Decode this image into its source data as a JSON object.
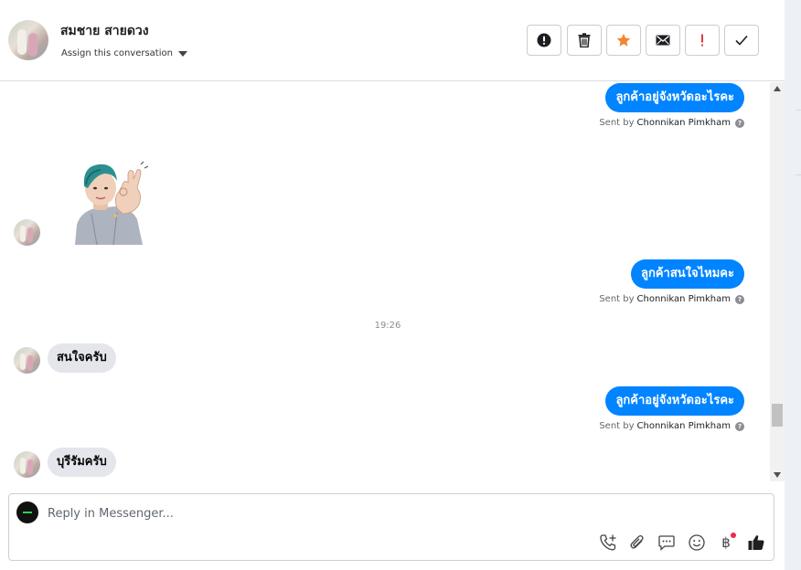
{
  "header": {
    "contact_name": "สมชาย สายดวง",
    "assign_label": "Assign this conversation"
  },
  "toolbar": {
    "buttons": [
      {
        "name": "info",
        "icon": "alert-circle-icon"
      },
      {
        "name": "delete",
        "icon": "trash-icon"
      },
      {
        "name": "star",
        "icon": "star-icon",
        "color": "#f5842b"
      },
      {
        "name": "mail",
        "icon": "envelope-icon"
      },
      {
        "name": "important",
        "icon": "exclamation-icon",
        "color": "#e0393e"
      },
      {
        "name": "done",
        "icon": "check-icon"
      }
    ]
  },
  "messages": [
    {
      "type": "outgoing",
      "text": "ลูกค้าอยู่จังหวัดอะไรคะ",
      "sent_by_prefix": "Sent by",
      "agent": "Chonnikan Pimkham"
    },
    {
      "type": "incoming-sticker",
      "sticker": "ok-hand-sticker"
    },
    {
      "type": "outgoing",
      "text": "ลูกค้าสนใจไหมคะ",
      "sent_by_prefix": "Sent by",
      "agent": "Chonnikan Pimkham"
    },
    {
      "type": "timestamp",
      "text": "19:26"
    },
    {
      "type": "incoming",
      "text": "สนใจครับ"
    },
    {
      "type": "outgoing",
      "text": "ลูกค้าอยู่จังหวัดอะไรคะ",
      "sent_by_prefix": "Sent by",
      "agent": "Chonnikan Pimkham"
    },
    {
      "type": "incoming",
      "text": "บุรีรัมครับ"
    }
  ],
  "composer": {
    "placeholder": "Reply in Messenger...",
    "icons": [
      "phone-add-icon",
      "paperclip-icon",
      "saved-reply-icon",
      "emoji-icon",
      "baht-payment-icon",
      "thumbs-up-icon"
    ]
  },
  "colors": {
    "outgoing_bubble": "#0084ff",
    "incoming_bubble": "#e4e6eb",
    "notification_dot": "#f02849"
  }
}
